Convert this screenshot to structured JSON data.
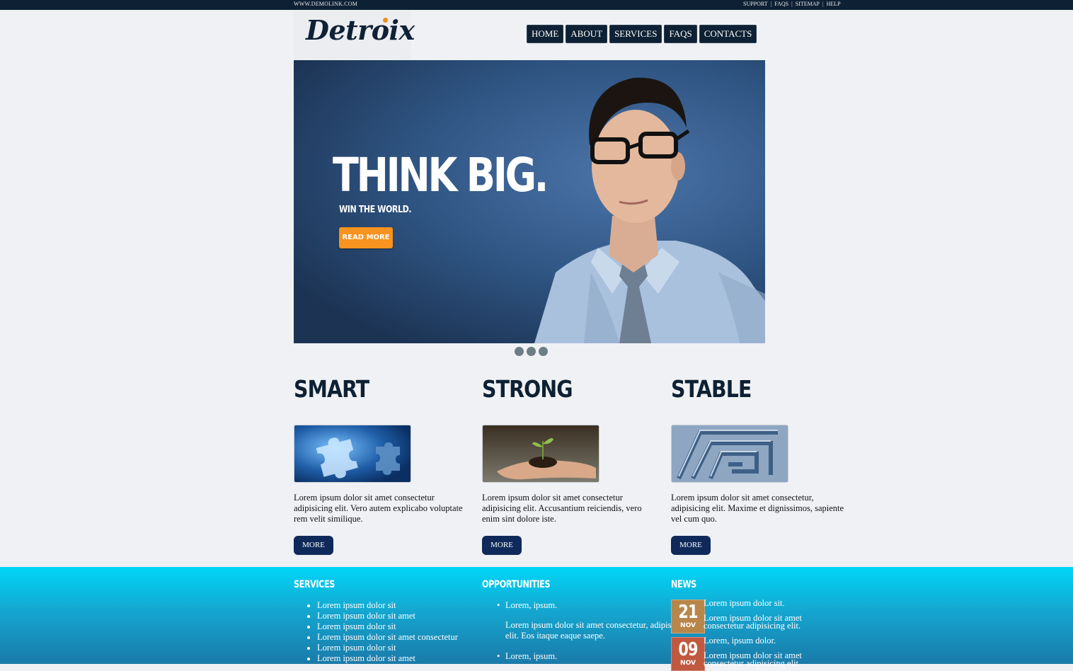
{
  "topbar": {
    "site": "WWW.DEMOLINK.COM",
    "links": [
      "SUPPORT",
      "FAQS",
      "SITEMAP",
      "HELP"
    ]
  },
  "logo": {
    "text": "Detroix"
  },
  "nav": [
    "HOME",
    "ABOUT",
    "SERVICES",
    "FAQS",
    "CONTACTS"
  ],
  "banner": {
    "headline": "THINK BIG.",
    "subline": "WIN THE WORLD.",
    "button": "READ MORE"
  },
  "slider_dots": 3,
  "features": [
    {
      "title": "SMART",
      "text": "Lorem ipsum dolor sit amet consectetur adipisicing elit. Vero autem explicabo voluptate rem velit similique.",
      "button": "MORE"
    },
    {
      "title": "STRONG",
      "text": "Lorem ipsum dolor sit amet consectetur adipisicing elit. Accusantium reiciendis, vero enim sint dolore iste.",
      "button": "MORE"
    },
    {
      "title": "STABLE",
      "text": "Lorem ipsum dolor sit amet consectetur, adipisicing elit. Maxime et dignissimos, sapiente vel cum quo.",
      "button": "MORE"
    }
  ],
  "footer": {
    "services": {
      "title": "SERVICES",
      "items": [
        "Lorem ipsum dolor sit",
        "Lorem ipsum dolor sit amet",
        "Lorem ipsum dolor sit",
        "Lorem ipsum dolor sit amet consectetur",
        "Lorem ipsum dolor sit",
        "Lorem ipsum dolor sit amet"
      ]
    },
    "opportunities": {
      "title": "OPPORTUNITIES",
      "item1": "Lorem, ipsum.",
      "desc1": "Lorem ipsum dolor sit amet consectetur, adipisicing elit. Eos itaque eaque saepe.",
      "item2": "Lorem, ipsum."
    },
    "news": {
      "title": "NEWS",
      "items": [
        {
          "day": "21",
          "month": "NOV",
          "title": "Lorem ipsum dolor sit.",
          "text": "Lorem ipsum dolor sit amet consectetur adipisicing elit.",
          "color": "#b8864a"
        },
        {
          "day": "09",
          "month": "NOV",
          "title": "Lorem, ipsum dolor.",
          "text": "Lorem ipsum dolor sit amet consectetur adipisicing elit.",
          "color": "#c0593f"
        }
      ]
    }
  }
}
